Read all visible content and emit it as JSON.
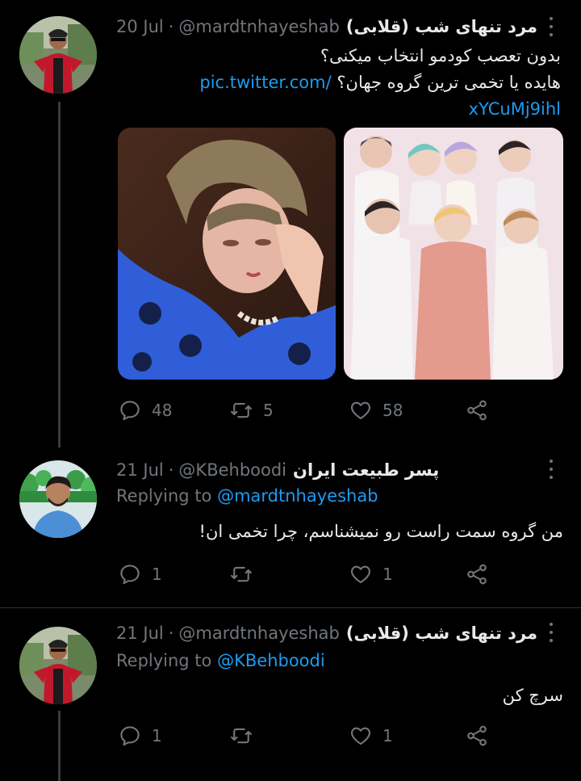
{
  "tweets": [
    {
      "name": "مرد تنهای شب (قلابی)",
      "handle": "@mardtnhayeshab",
      "separator": "·",
      "date": "20 Jul",
      "line1": "بدون تعصب کودمو انتخاب میکنی؟",
      "line2": "هایده یا تخمی ترین گروه جهان؟",
      "link_part1": "pic.twitter.com/",
      "link_part2": "xYCuMj9ihl",
      "reply_count": "48",
      "retweet_count": "5",
      "like_count": "58"
    },
    {
      "name": "پسر طبیعت ایران",
      "handle": "@KBehboodi",
      "separator": "·",
      "date": "21 Jul",
      "replying_prefix": "Replying to",
      "replying_to": "@mardtnhayeshab",
      "text": "من گروه سمت راست رو نمیشناسم، چرا تخمی ان!",
      "reply_count": "1",
      "retweet_count": "",
      "like_count": "1"
    },
    {
      "name": "مرد تنهای شب (قلابی)",
      "handle": "@mardtnhayeshab",
      "separator": "·",
      "date": "21 Jul",
      "replying_prefix": "Replying to",
      "replying_to": "@KBehboodi",
      "text": "سرچ کن",
      "reply_count": "1",
      "retweet_count": "",
      "like_count": "1"
    }
  ],
  "icons": {
    "reply": "reply-icon",
    "retweet": "retweet-icon",
    "like": "heart-icon",
    "share": "share-icon",
    "more": "more-options-icon"
  },
  "colors": {
    "background": "#000000",
    "text": "#e7e9ea",
    "secondary": "#71767b",
    "link": "#1d9bf0",
    "thread_line": "#3a3d40"
  }
}
